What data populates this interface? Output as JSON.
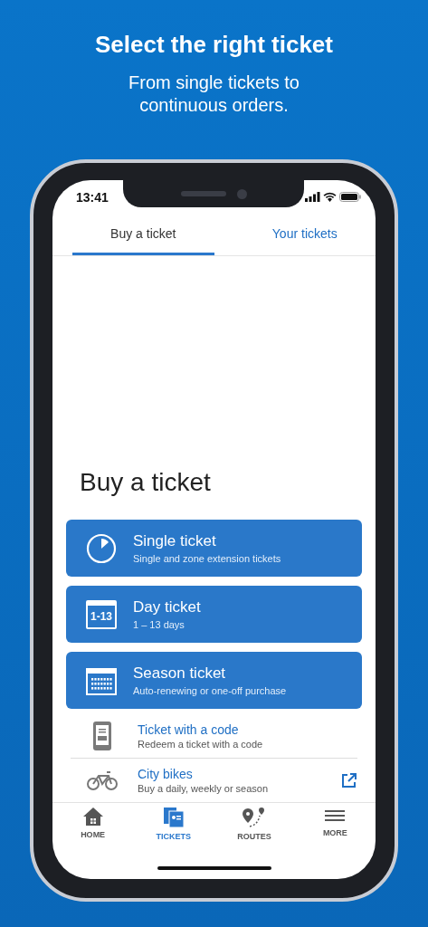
{
  "header": {
    "title": "Select the right ticket",
    "subtitle": "From single tickets to continuous orders."
  },
  "status_bar": {
    "time": "13:41"
  },
  "tabs": [
    {
      "label": "Buy a ticket",
      "selected": true
    },
    {
      "label": "Your tickets",
      "selected": false
    }
  ],
  "heading": "Buy a ticket",
  "ticket_types": [
    {
      "kind": "stopwatch",
      "title": "Single ticket",
      "subtitle": "Single and zone extension tickets"
    },
    {
      "kind": "day",
      "title": "Day ticket",
      "subtitle": "1 – 13 days",
      "icon_label": "1-13"
    },
    {
      "kind": "season",
      "title": "Season ticket",
      "subtitle": "Auto-renewing or one-off purchase"
    }
  ],
  "links": [
    {
      "kind": "code",
      "title": "Ticket with a code",
      "subtitle": "Redeem a ticket with a code",
      "external": false
    },
    {
      "kind": "bike",
      "title": "City bikes",
      "subtitle": "Buy a daily, weekly or season",
      "external": true
    }
  ],
  "nav": [
    {
      "kind": "home",
      "label": "HOME",
      "selected": false
    },
    {
      "kind": "tickets",
      "label": "TICKETS",
      "selected": true
    },
    {
      "kind": "routes",
      "label": "ROUTES",
      "selected": false
    },
    {
      "kind": "more",
      "label": "MORE",
      "selected": false
    }
  ]
}
